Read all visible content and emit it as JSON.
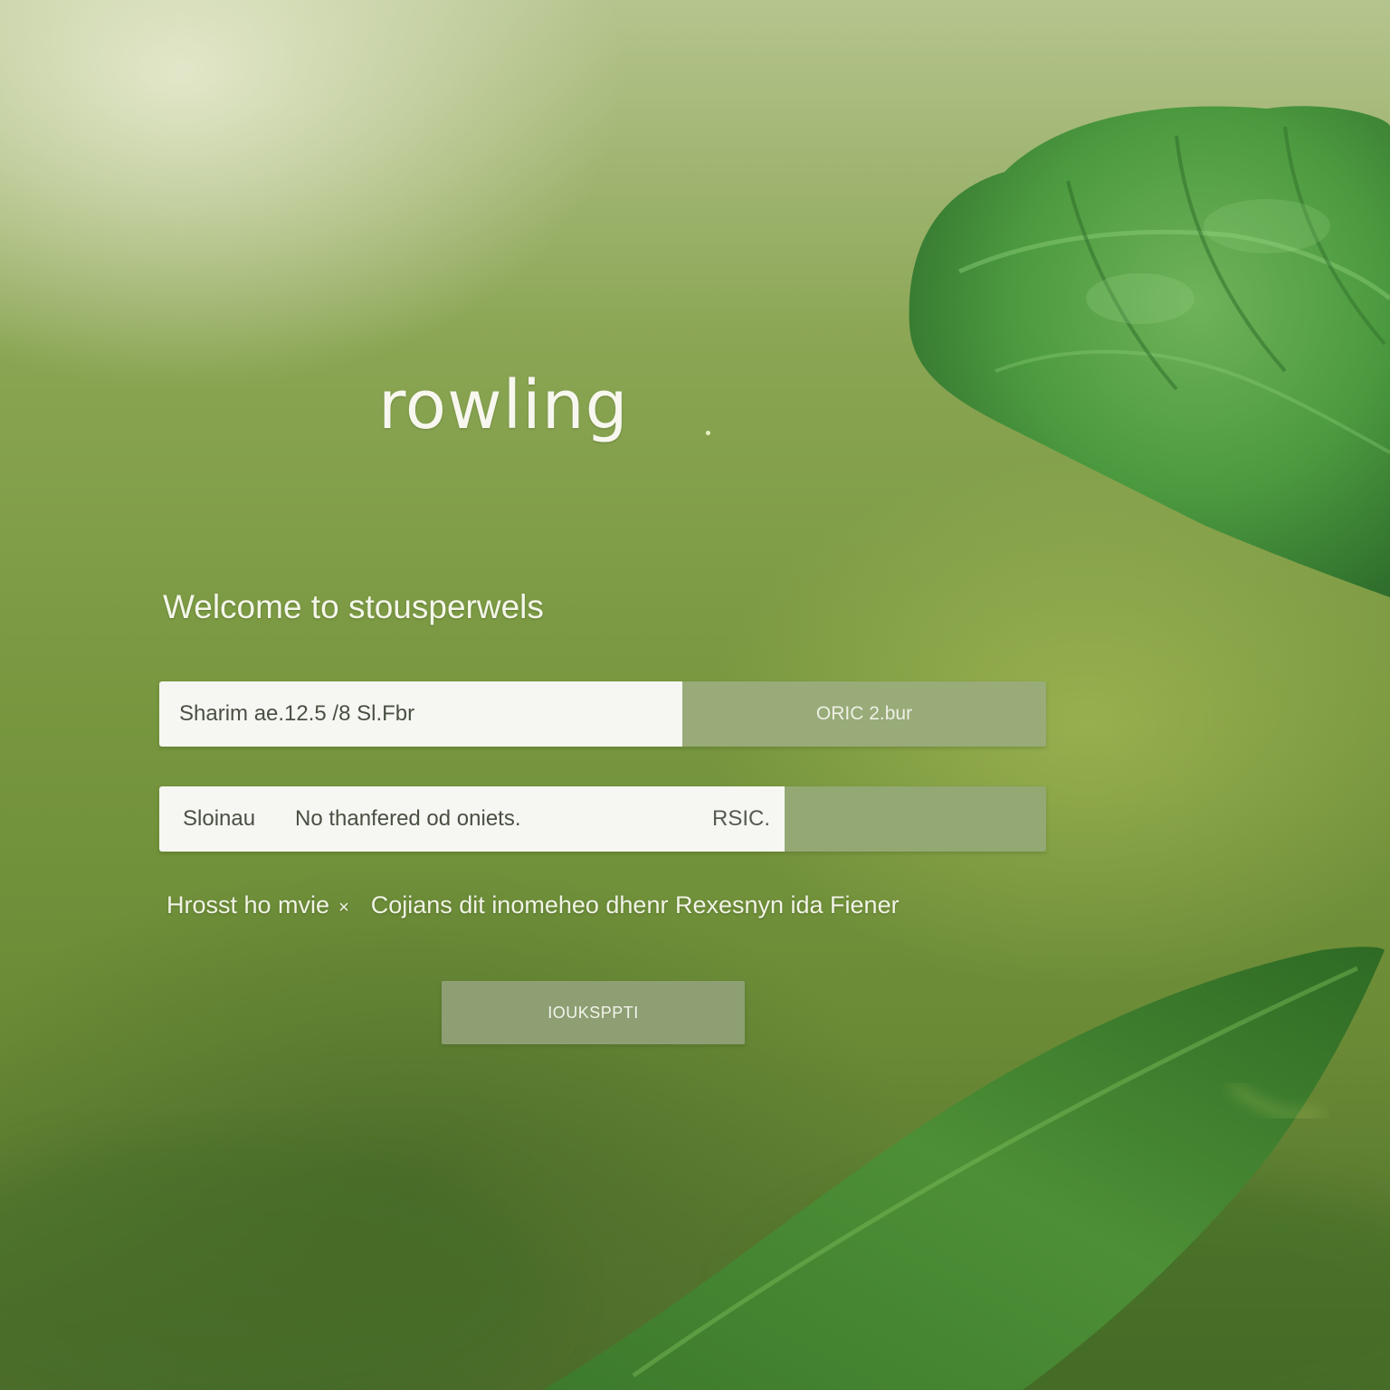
{
  "app": {
    "logo_text": "rowling"
  },
  "welcome": {
    "heading": "Welcome to stousperwels"
  },
  "form": {
    "row1": {
      "field_value": "Sharim ae.12.5  /8 Sl.Fbr",
      "side_button_label": "ORIC 2.bur"
    },
    "row2": {
      "field_label": "Sloinau",
      "field_value": "No thanfered od oniets.",
      "field_tag": "RSIC.",
      "side_button_label": ""
    },
    "hint": {
      "left_text": "Hrosst ho mvie",
      "close_glyph": "×",
      "right_text": "Cojians dit inomeheo dhenr Rexesnyn ida Fiener"
    },
    "submit_label": "IOUKSPPTI"
  },
  "colors": {
    "background": "#78973f",
    "input_bg": "#f6f7f2",
    "side_button_bg": "#98ab78",
    "primary_button_bg": "#8d9f73",
    "text_light": "#f4f6ea"
  },
  "icons": {
    "hint_close": "close-icon"
  }
}
